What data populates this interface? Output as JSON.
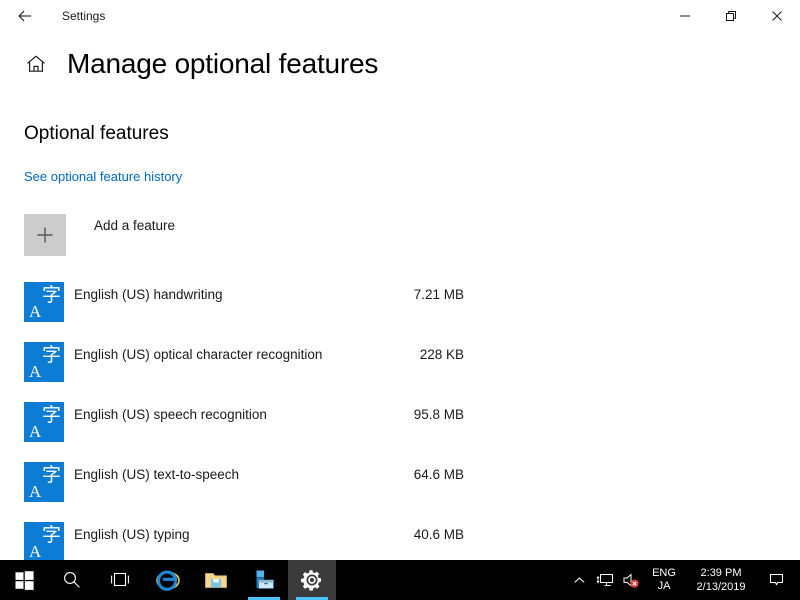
{
  "window": {
    "title": "Settings",
    "back_icon": "back-arrow-icon",
    "minimize_label": "—",
    "restore_label": "❐",
    "close_label": "✕"
  },
  "header": {
    "home_icon": "home-icon",
    "page_title": "Manage optional features"
  },
  "content": {
    "section_title": "Optional features",
    "history_link": "See optional feature history",
    "add_feature_label": "Add a feature",
    "add_feature_icon": "plus-icon",
    "features": [
      {
        "name": "English (US) handwriting",
        "size": "7.21 MB",
        "icon": "language-pack-icon"
      },
      {
        "name": "English (US) optical character recognition",
        "size": "228 KB",
        "icon": "language-pack-icon"
      },
      {
        "name": "English (US) speech recognition",
        "size": "95.8 MB",
        "icon": "language-pack-icon"
      },
      {
        "name": "English (US) text-to-speech",
        "size": "64.6 MB",
        "icon": "language-pack-icon"
      },
      {
        "name": "English (US) typing",
        "size": "40.6 MB",
        "icon": "language-pack-icon"
      }
    ]
  },
  "taskbar": {
    "buttons": [
      {
        "name": "start-button",
        "icon": "windows-logo-icon",
        "active": false
      },
      {
        "name": "search-button",
        "icon": "search-icon",
        "active": false
      },
      {
        "name": "task-view-button",
        "icon": "task-view-icon",
        "active": false
      },
      {
        "name": "internet-explorer-button",
        "icon": "internet-explorer-icon",
        "active": false
      },
      {
        "name": "file-explorer-button",
        "icon": "folder-icon",
        "active": false
      },
      {
        "name": "microsoft-store-button",
        "icon": "store-bag-icon",
        "active": false
      },
      {
        "name": "settings-button",
        "icon": "gear-icon",
        "active": true
      }
    ],
    "tray": {
      "chevron_icon": "chevron-up-icon",
      "network_icon": "network-monitor-icon",
      "volume_icon": "speaker-muted-icon",
      "language_primary": "ENG",
      "language_secondary": "JA",
      "time": "2:39 PM",
      "date": "2/13/2019",
      "action_center_icon": "action-center-icon"
    }
  },
  "colors": {
    "accent": "#0078d7",
    "link": "#0067c0",
    "icon_blue": "#0c7cd5",
    "taskbar": "#000000",
    "active_tab_bg": "#3b3b3b",
    "underline": "#4cc2ff",
    "add_box": "#cccccc"
  }
}
